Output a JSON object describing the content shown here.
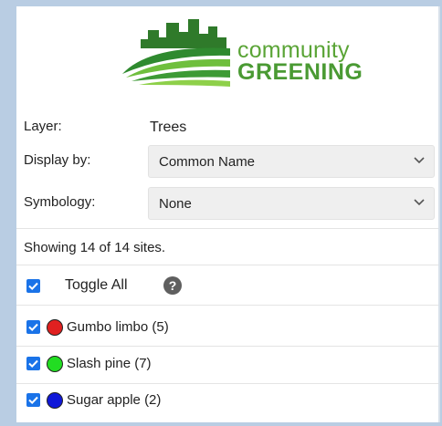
{
  "logo": {
    "line1": "community",
    "line2": "GREENING",
    "color": "#4a9a33"
  },
  "layer": {
    "label": "Layer:",
    "value": "Trees"
  },
  "display_by": {
    "label": "Display by:",
    "value": "Common Name"
  },
  "symbology": {
    "label": "Symbology:",
    "value": "None"
  },
  "status": "Showing 14 of 14 sites.",
  "toggle_all": {
    "label": "Toggle All",
    "checked": true,
    "help_glyph": "?"
  },
  "items": [
    {
      "label": "Gumbo limbo (5)",
      "color": "#e02020",
      "checked": true
    },
    {
      "label": "Slash pine (7)",
      "color": "#22dd22",
      "checked": true
    },
    {
      "label": "Sugar apple (2)",
      "color": "#1018d8",
      "checked": true
    }
  ],
  "accent": "#1a73e8"
}
